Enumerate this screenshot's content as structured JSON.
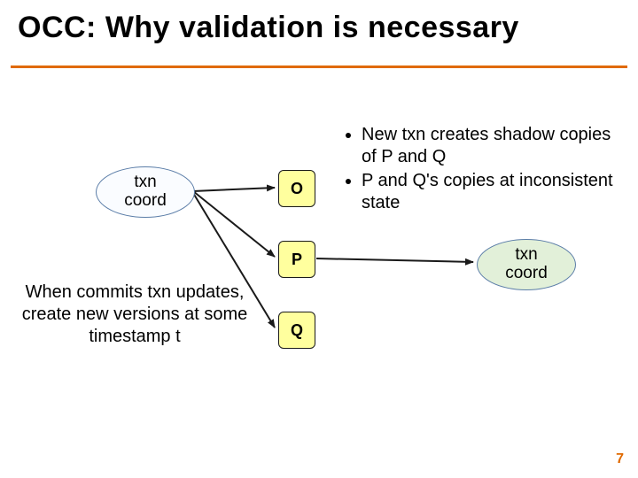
{
  "title": "OCC:  Why validation is necessary",
  "coord_left": {
    "line1": "txn",
    "line2": "coord"
  },
  "coord_right": {
    "line1": "txn",
    "line2": "coord"
  },
  "nodes": {
    "o": "O",
    "p": "P",
    "q": "Q"
  },
  "bullets": {
    "b1": "New txn creates shadow copies of P and Q",
    "b2": "P and Q's copies at inconsistent state"
  },
  "caption": "When commits txn updates, create new versions at some timestamp t",
  "page": "7",
  "colors": {
    "accent": "#e06a00",
    "node_fill": "#ffff9e",
    "coord_right_fill": "#e2f0d9"
  }
}
